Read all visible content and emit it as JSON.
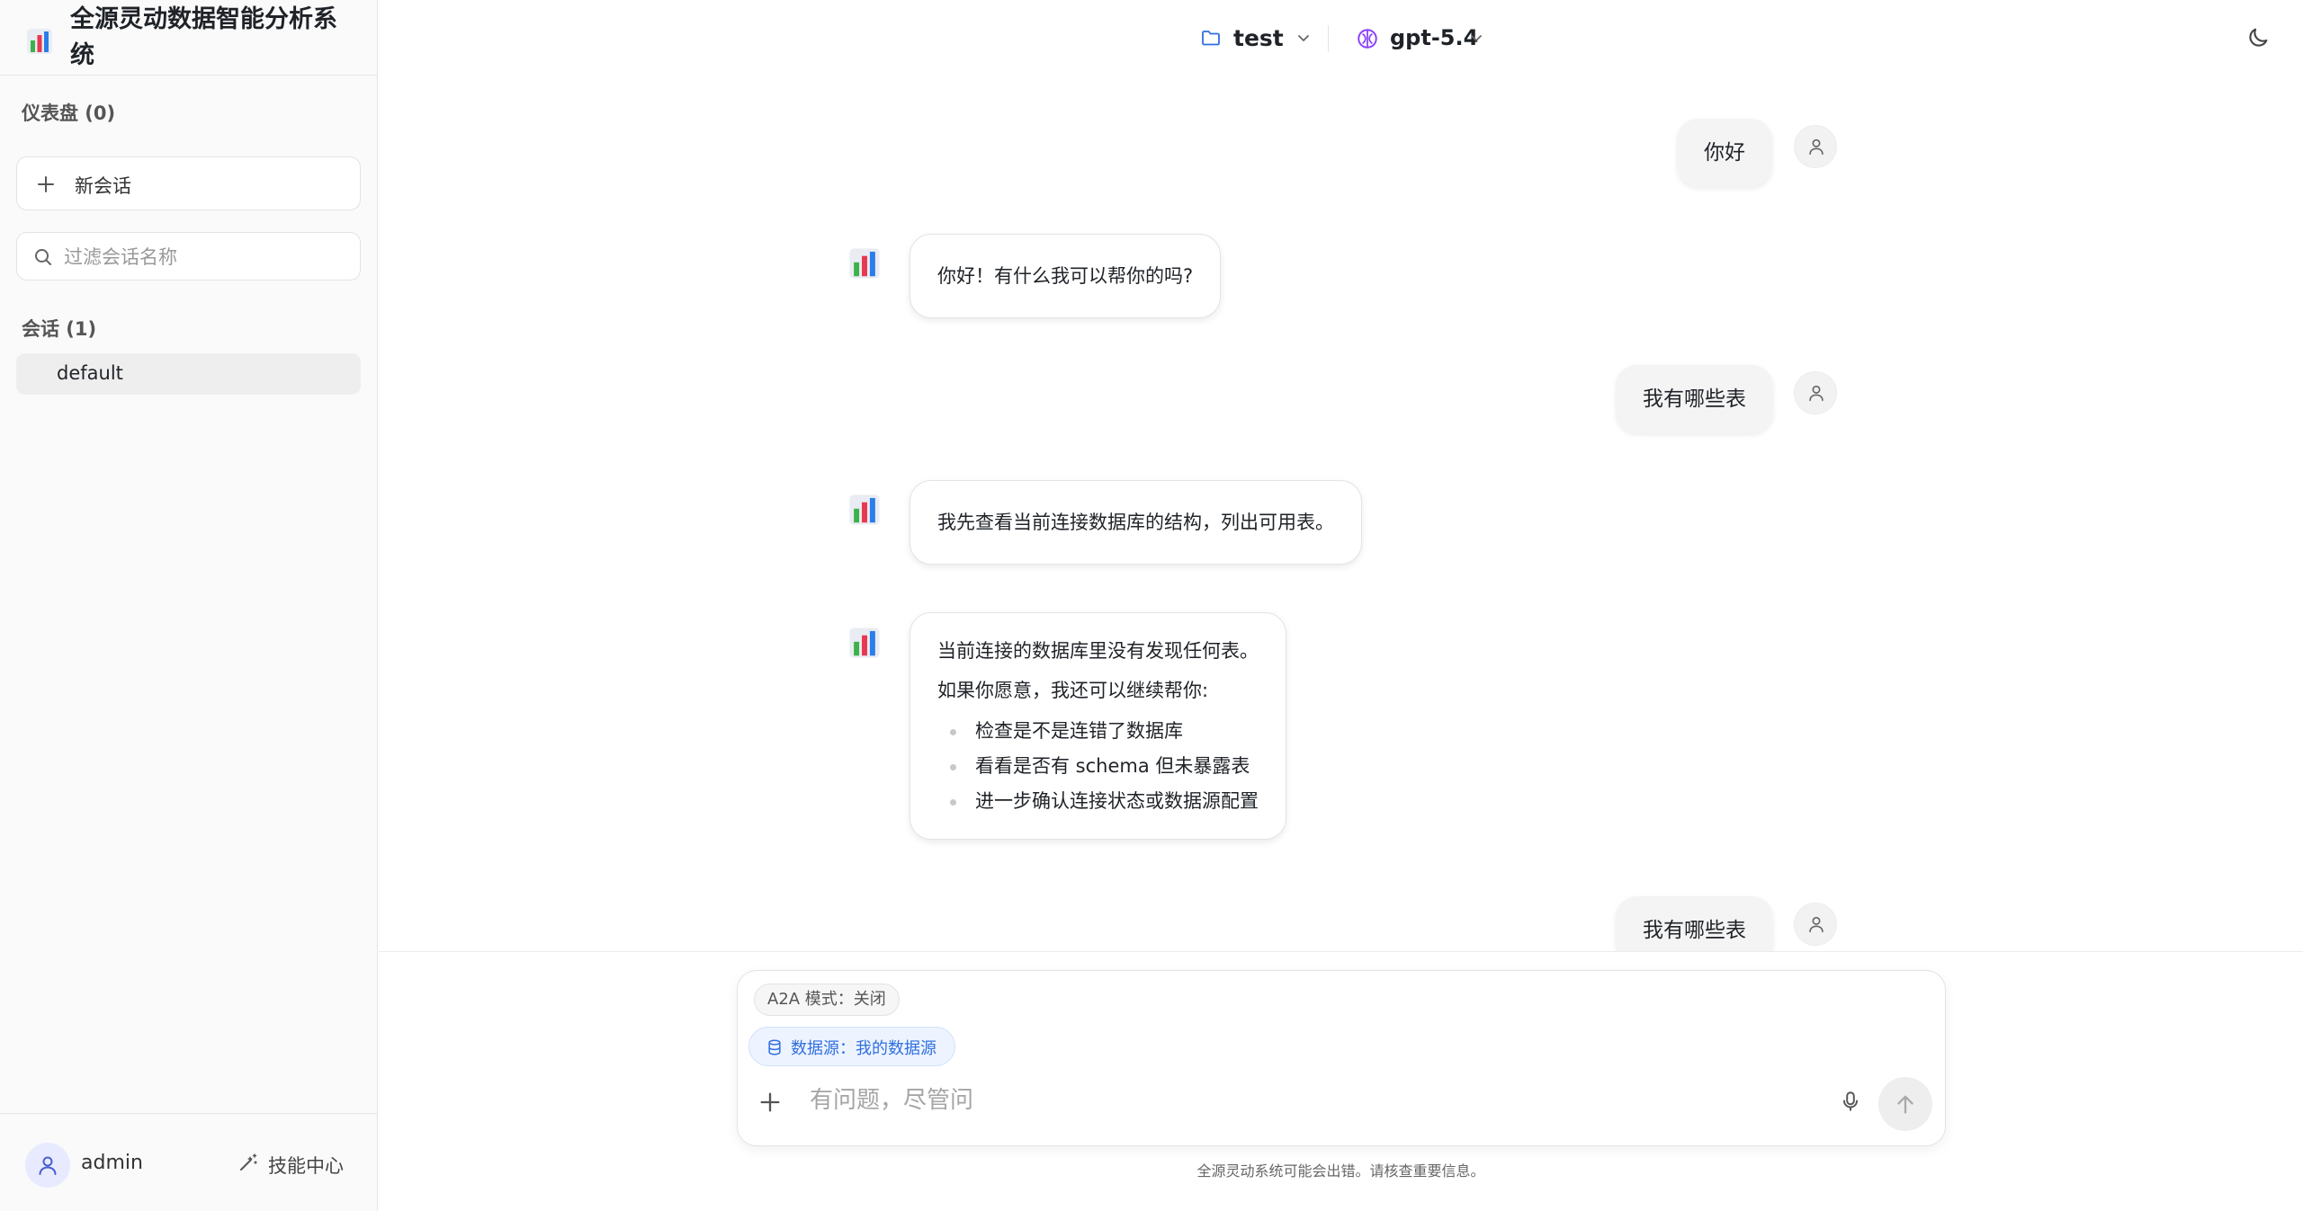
{
  "app": {
    "title": "全源灵动数据智能分析系统",
    "logo_icon": "bar-chart-logo-icon"
  },
  "sidebar": {
    "dashboard_label": "仪表盘 (0)",
    "new_chat_label": "新会话",
    "filter_placeholder": "过滤会话名称",
    "conversations_label": "会话 (1)",
    "conversations": [
      {
        "label": "default",
        "selected": true
      }
    ],
    "user_name": "admin",
    "skill_center_label": "技能中心"
  },
  "topbar": {
    "project_name": "test",
    "model_name": "gpt-5.4",
    "theme_icon": "moon-icon"
  },
  "messages": [
    {
      "role": "user",
      "text": "你好"
    },
    {
      "role": "assistant",
      "text": "你好！有什么我可以帮你的吗?"
    },
    {
      "role": "user",
      "text": "我有哪些表"
    },
    {
      "role": "assistant",
      "text": "我先查看当前连接数据库的结构，列出可用表。"
    },
    {
      "role": "assistant",
      "paragraphs": [
        "当前连接的数据库里没有发现任何表。",
        "如果你愿意，我还可以继续帮你:"
      ],
      "bullets": [
        "检查是不是连错了数据库",
        "看看是否有 schema 但未暴露表",
        "进一步确认连接状态或数据源配置"
      ]
    },
    {
      "role": "user",
      "text": "我有哪些表"
    }
  ],
  "composer": {
    "a2a_chip": "A2A 模式：关闭",
    "datasource_chip": "数据源：我的数据源",
    "placeholder": "有问题，尽管问",
    "disclaimer": "全源灵动系统可能会出错。请核查重要信息。"
  },
  "colors": {
    "accent_blue": "#2f6fe0",
    "model_purple": "#8a3ffc",
    "sidebar_bg": "#fafafa"
  }
}
